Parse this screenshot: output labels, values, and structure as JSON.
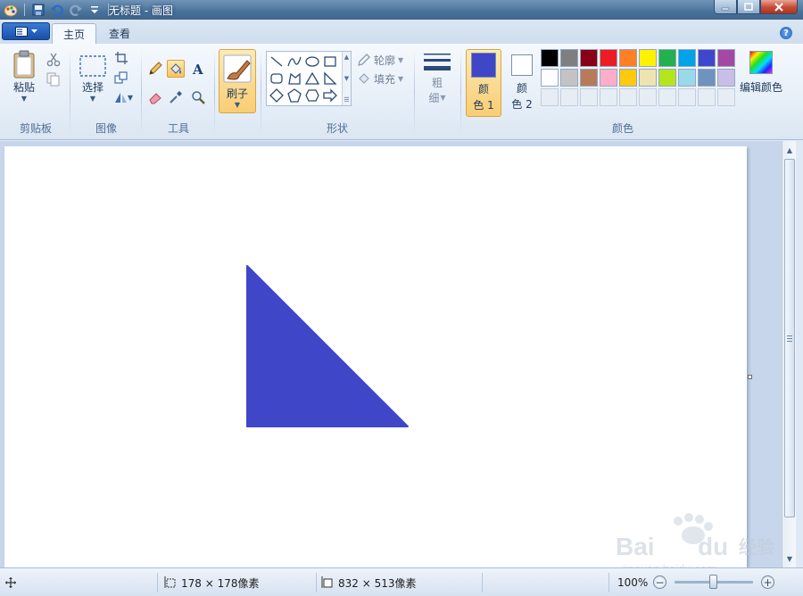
{
  "window": {
    "title": "无标题 - 画图"
  },
  "tabs": [
    {
      "label": "主页",
      "active": true
    },
    {
      "label": "查看",
      "active": false
    }
  ],
  "groups": {
    "clipboard": {
      "label": "剪贴板",
      "paste": "粘贴"
    },
    "image": {
      "label": "图像",
      "select": "选择"
    },
    "tools": {
      "label": "工具",
      "selected_tool": "fill-icon"
    },
    "brushes": {
      "label": "刷子"
    },
    "shapes": {
      "label": "形状",
      "outline": "轮廓",
      "fill": "填充"
    },
    "size": {
      "label_line1": "粗",
      "label_line2": "细"
    },
    "colors": {
      "label": "颜色",
      "color1": {
        "line1": "颜",
        "line2": "色 1",
        "value": "#4046c8"
      },
      "color2": {
        "line1": "颜",
        "line2": "色 2",
        "value": "#ffffff"
      },
      "edit": "编辑颜色",
      "palette_row1": [
        "#000000",
        "#7f7f7f",
        "#880015",
        "#ed1c24",
        "#ff7f27",
        "#fff200",
        "#22b14c",
        "#00a2e8",
        "#3f48cc",
        "#a349a4"
      ],
      "palette_row2": [
        "#ffffff",
        "#c3c3c3",
        "#b97a57",
        "#ffaec9",
        "#ffc90e",
        "#efe4b0",
        "#b5e61d",
        "#99d9ea",
        "#7092be",
        "#c8bfe7"
      ],
      "palette_row3": [
        "#e6edf5",
        "#e6edf5",
        "#e6edf5",
        "#e6edf5",
        "#e6edf5",
        "#e6edf5",
        "#e6edf5",
        "#e6edf5",
        "#e6edf5",
        "#e6edf5"
      ]
    }
  },
  "canvas": {
    "shape": "right-triangle",
    "shape_color": "#4046c8"
  },
  "status": {
    "selection_size": "178 × 178像素",
    "canvas_size": "832 × 513像素",
    "zoom": "100%"
  },
  "watermark": {
    "brand": "Baidu经验",
    "url": "jingyan.baidu.com"
  }
}
